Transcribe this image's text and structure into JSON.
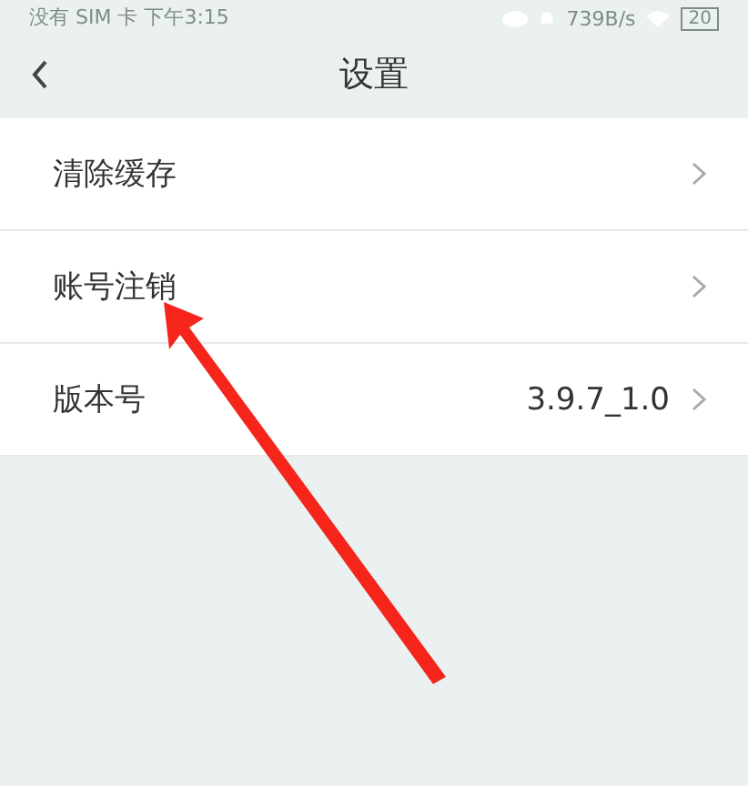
{
  "status_bar": {
    "carrier_time": "没有 SIM 卡 下午3:15",
    "speed": "739B/s",
    "battery": "20"
  },
  "header": {
    "title": "设置"
  },
  "items": [
    {
      "label": "清除缓存"
    },
    {
      "label": "账号注销"
    },
    {
      "label": "版本号",
      "value": "3.9.7_1.0"
    }
  ],
  "annotation": {
    "kind": "arrow"
  }
}
